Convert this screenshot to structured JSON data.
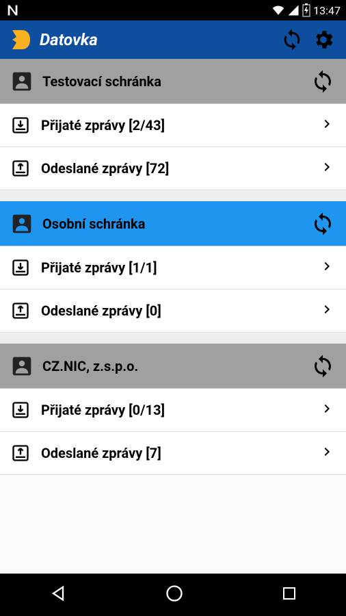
{
  "status_bar": {
    "time": "13:47"
  },
  "header": {
    "app_title": "Datovka"
  },
  "accounts": [
    {
      "name": "Testovací schránka",
      "style": "grey",
      "folders": [
        {
          "label": "Přijaté zprávy   [2/43]",
          "type": "inbox"
        },
        {
          "label": "Odeslané zprávy   [72]",
          "type": "outbox"
        }
      ]
    },
    {
      "name": "Osobní schránka",
      "style": "blue",
      "folders": [
        {
          "label": "Přijaté zprávy   [1/1]",
          "type": "inbox"
        },
        {
          "label": "Odeslané zprávy   [0]",
          "type": "outbox"
        }
      ]
    },
    {
      "name": "CZ.NIC, z.s.p.o.",
      "style": "grey",
      "folders": [
        {
          "label": "Přijaté zprávy   [0/13]",
          "type": "inbox"
        },
        {
          "label": "Odeslané zprávy   [7]",
          "type": "outbox"
        }
      ]
    }
  ]
}
